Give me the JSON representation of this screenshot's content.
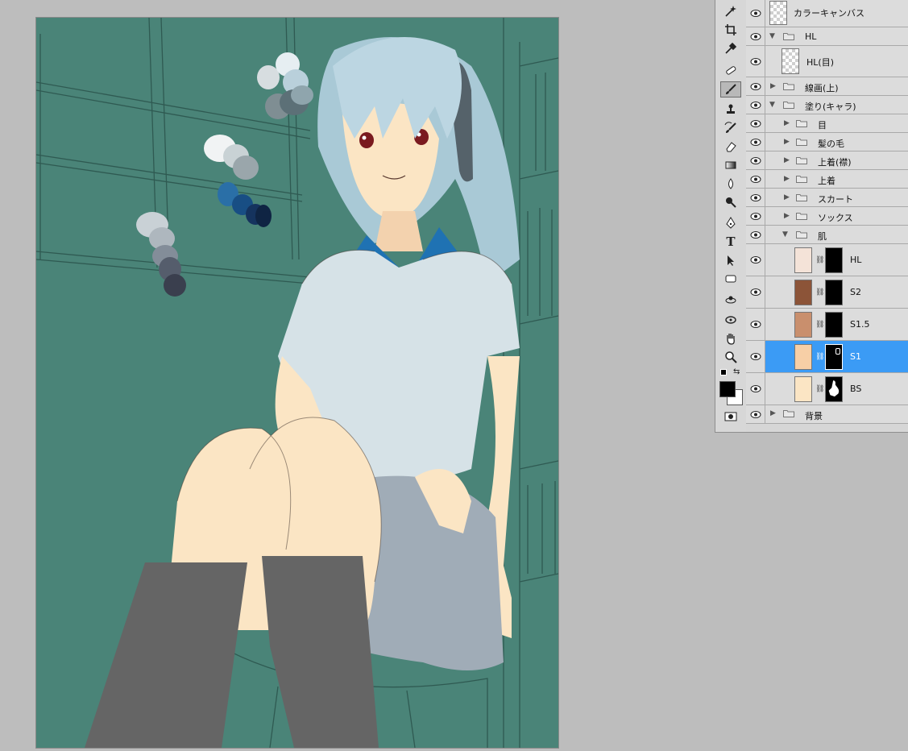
{
  "layers": [
    {
      "name": "カラーキャンバス",
      "kind": "layer"
    },
    {
      "name": "HL",
      "kind": "group",
      "expanded": true
    },
    {
      "name": "HL(目)",
      "kind": "layer"
    },
    {
      "name": "線画(上)",
      "kind": "group",
      "expanded": false
    },
    {
      "name": "塗り(キャラ)",
      "kind": "group",
      "expanded": true
    },
    {
      "name": "目",
      "kind": "group",
      "expanded": false
    },
    {
      "name": "髪の毛",
      "kind": "group",
      "expanded": false
    },
    {
      "name": "上着(襟)",
      "kind": "group",
      "expanded": false
    },
    {
      "name": "上着",
      "kind": "group",
      "expanded": false
    },
    {
      "name": "スカート",
      "kind": "group",
      "expanded": false
    },
    {
      "name": "ソックス",
      "kind": "group",
      "expanded": false
    },
    {
      "name": "肌",
      "kind": "group",
      "expanded": true
    },
    {
      "name": "HL",
      "kind": "masked-layer",
      "color": "#f4e3d8"
    },
    {
      "name": "S2",
      "kind": "masked-layer",
      "color": "#8c5438"
    },
    {
      "name": "S1.5",
      "kind": "masked-layer",
      "color": "#c98f6d"
    },
    {
      "name": "S1",
      "kind": "masked-layer",
      "color": "#f7cfa6",
      "selected": true
    },
    {
      "name": "BS",
      "kind": "masked-layer",
      "color": "#fbe5c4"
    },
    {
      "name": "背景",
      "kind": "group",
      "expanded": false
    }
  ],
  "tools": [
    "magic-wand-icon",
    "crop-icon",
    "eyedropper-icon",
    "healing-brush-icon",
    "brush-icon",
    "clone-stamp-icon",
    "history-brush-icon",
    "eraser-icon",
    "gradient-icon",
    "blur-icon",
    "dodge-icon",
    "pen-icon",
    "type-icon",
    "path-select-icon",
    "shape-icon",
    "3d-rotate-icon",
    "3d-orbit-icon",
    "hand-icon",
    "zoom-icon"
  ],
  "tool_labels": {
    "type": "T"
  },
  "colors": {
    "foreground": "#000000",
    "background": "#ffffff",
    "canvas_bg": "#4a8478",
    "selection": "#3b9bf5"
  }
}
